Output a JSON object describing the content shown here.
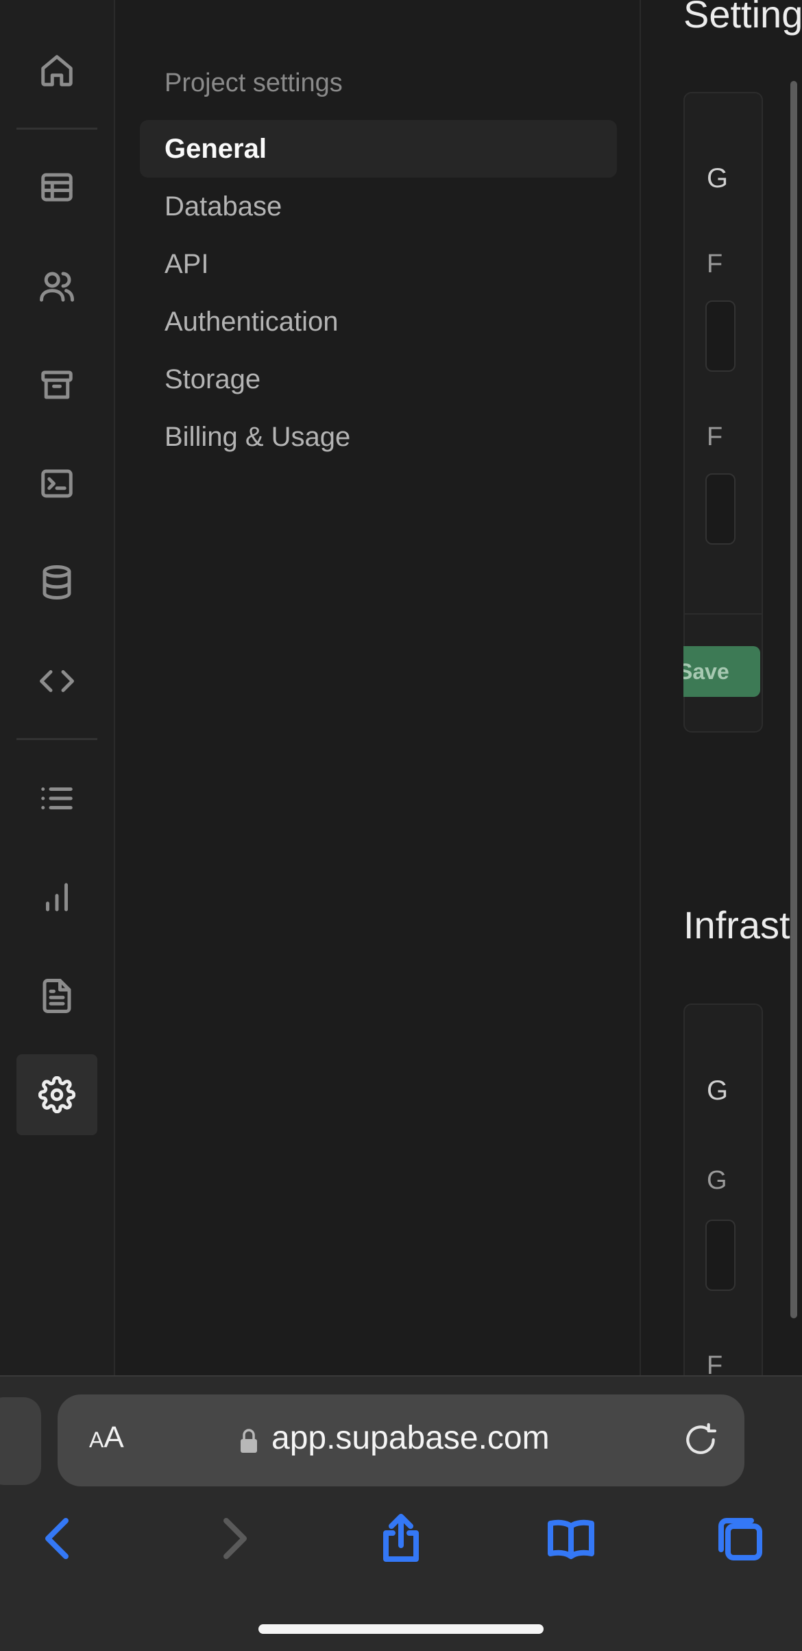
{
  "rail": {
    "items": [
      {
        "name": "home-icon"
      },
      {
        "name": "table-editor-icon"
      },
      {
        "name": "users-icon"
      },
      {
        "name": "storage-icon"
      },
      {
        "name": "sql-editor-icon"
      },
      {
        "name": "database-icon"
      },
      {
        "name": "code-icon"
      },
      {
        "name": "list-icon"
      },
      {
        "name": "bar-chart-icon"
      },
      {
        "name": "document-icon"
      },
      {
        "name": "gear-icon",
        "active": true
      }
    ]
  },
  "menu": {
    "title": "Project settings",
    "items": [
      {
        "label": "General",
        "active": true
      },
      {
        "label": "Database"
      },
      {
        "label": "API"
      },
      {
        "label": "Authentication"
      },
      {
        "label": "Storage"
      },
      {
        "label": "Billing & Usage"
      }
    ]
  },
  "content": {
    "section1_title": "Setting",
    "section2_title": "Infrast",
    "card1_heading": "G",
    "card1_field1_label": "F",
    "card1_field2_label": "F",
    "save_label": "Save",
    "card2_heading": "G",
    "card2_field1_label": "G",
    "card2_field2_label": "F"
  },
  "browser": {
    "text_size_label_small": "A",
    "text_size_label_large": "A",
    "url": "app.supabase.com",
    "accent": "#3478f6"
  },
  "colors": {
    "background": "#1c1c1c",
    "save_button": "#3d7a55"
  }
}
